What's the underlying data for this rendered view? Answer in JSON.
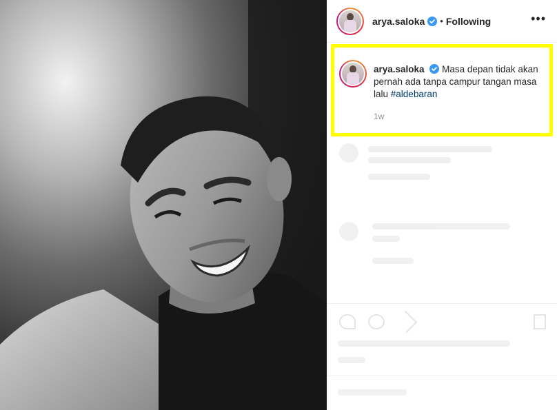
{
  "post": {
    "username": "arya.saloka",
    "dot": "•",
    "follow_status": "Following",
    "more_label": "•••",
    "icons": {
      "verified": "verified-badge-icon",
      "more": "more-options-icon"
    },
    "colors": {
      "verified": "#3897f0",
      "hashtag": "#00376b",
      "highlight": "#ffff00"
    }
  },
  "caption": {
    "username": "arya.saloka",
    "text": "Masa depan tidak akan pernah ada tanpa campur tangan masa lalu",
    "hashtag": "#aldebaran",
    "time_ago": "1w"
  }
}
